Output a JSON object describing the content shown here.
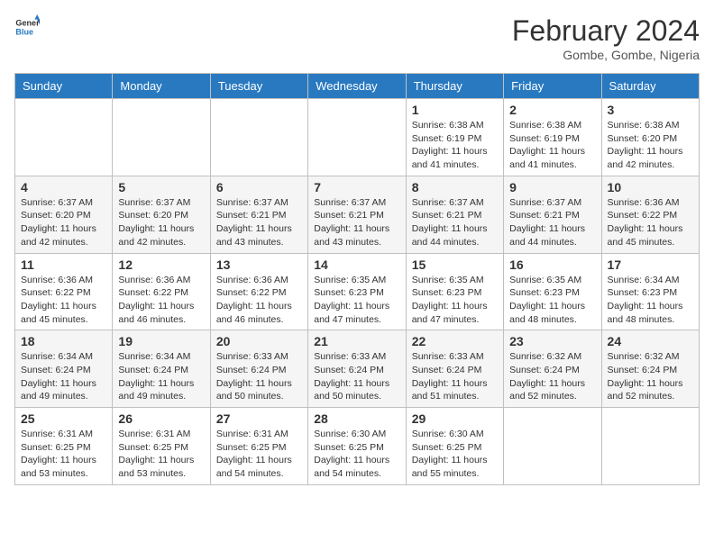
{
  "logo": {
    "line1": "General",
    "line2": "Blue"
  },
  "title": "February 2024",
  "subtitle": "Gombe, Gombe, Nigeria",
  "days_of_week": [
    "Sunday",
    "Monday",
    "Tuesday",
    "Wednesday",
    "Thursday",
    "Friday",
    "Saturday"
  ],
  "weeks": [
    [
      {
        "day": "",
        "info": ""
      },
      {
        "day": "",
        "info": ""
      },
      {
        "day": "",
        "info": ""
      },
      {
        "day": "",
        "info": ""
      },
      {
        "day": "1",
        "info": "Sunrise: 6:38 AM\nSunset: 6:19 PM\nDaylight: 11 hours and 41 minutes."
      },
      {
        "day": "2",
        "info": "Sunrise: 6:38 AM\nSunset: 6:19 PM\nDaylight: 11 hours and 41 minutes."
      },
      {
        "day": "3",
        "info": "Sunrise: 6:38 AM\nSunset: 6:20 PM\nDaylight: 11 hours and 42 minutes."
      }
    ],
    [
      {
        "day": "4",
        "info": "Sunrise: 6:37 AM\nSunset: 6:20 PM\nDaylight: 11 hours and 42 minutes."
      },
      {
        "day": "5",
        "info": "Sunrise: 6:37 AM\nSunset: 6:20 PM\nDaylight: 11 hours and 42 minutes."
      },
      {
        "day": "6",
        "info": "Sunrise: 6:37 AM\nSunset: 6:21 PM\nDaylight: 11 hours and 43 minutes."
      },
      {
        "day": "7",
        "info": "Sunrise: 6:37 AM\nSunset: 6:21 PM\nDaylight: 11 hours and 43 minutes."
      },
      {
        "day": "8",
        "info": "Sunrise: 6:37 AM\nSunset: 6:21 PM\nDaylight: 11 hours and 44 minutes."
      },
      {
        "day": "9",
        "info": "Sunrise: 6:37 AM\nSunset: 6:21 PM\nDaylight: 11 hours and 44 minutes."
      },
      {
        "day": "10",
        "info": "Sunrise: 6:36 AM\nSunset: 6:22 PM\nDaylight: 11 hours and 45 minutes."
      }
    ],
    [
      {
        "day": "11",
        "info": "Sunrise: 6:36 AM\nSunset: 6:22 PM\nDaylight: 11 hours and 45 minutes."
      },
      {
        "day": "12",
        "info": "Sunrise: 6:36 AM\nSunset: 6:22 PM\nDaylight: 11 hours and 46 minutes."
      },
      {
        "day": "13",
        "info": "Sunrise: 6:36 AM\nSunset: 6:22 PM\nDaylight: 11 hours and 46 minutes."
      },
      {
        "day": "14",
        "info": "Sunrise: 6:35 AM\nSunset: 6:23 PM\nDaylight: 11 hours and 47 minutes."
      },
      {
        "day": "15",
        "info": "Sunrise: 6:35 AM\nSunset: 6:23 PM\nDaylight: 11 hours and 47 minutes."
      },
      {
        "day": "16",
        "info": "Sunrise: 6:35 AM\nSunset: 6:23 PM\nDaylight: 11 hours and 48 minutes."
      },
      {
        "day": "17",
        "info": "Sunrise: 6:34 AM\nSunset: 6:23 PM\nDaylight: 11 hours and 48 minutes."
      }
    ],
    [
      {
        "day": "18",
        "info": "Sunrise: 6:34 AM\nSunset: 6:24 PM\nDaylight: 11 hours and 49 minutes."
      },
      {
        "day": "19",
        "info": "Sunrise: 6:34 AM\nSunset: 6:24 PM\nDaylight: 11 hours and 49 minutes."
      },
      {
        "day": "20",
        "info": "Sunrise: 6:33 AM\nSunset: 6:24 PM\nDaylight: 11 hours and 50 minutes."
      },
      {
        "day": "21",
        "info": "Sunrise: 6:33 AM\nSunset: 6:24 PM\nDaylight: 11 hours and 50 minutes."
      },
      {
        "day": "22",
        "info": "Sunrise: 6:33 AM\nSunset: 6:24 PM\nDaylight: 11 hours and 51 minutes."
      },
      {
        "day": "23",
        "info": "Sunrise: 6:32 AM\nSunset: 6:24 PM\nDaylight: 11 hours and 52 minutes."
      },
      {
        "day": "24",
        "info": "Sunrise: 6:32 AM\nSunset: 6:24 PM\nDaylight: 11 hours and 52 minutes."
      }
    ],
    [
      {
        "day": "25",
        "info": "Sunrise: 6:31 AM\nSunset: 6:25 PM\nDaylight: 11 hours and 53 minutes."
      },
      {
        "day": "26",
        "info": "Sunrise: 6:31 AM\nSunset: 6:25 PM\nDaylight: 11 hours and 53 minutes."
      },
      {
        "day": "27",
        "info": "Sunrise: 6:31 AM\nSunset: 6:25 PM\nDaylight: 11 hours and 54 minutes."
      },
      {
        "day": "28",
        "info": "Sunrise: 6:30 AM\nSunset: 6:25 PM\nDaylight: 11 hours and 54 minutes."
      },
      {
        "day": "29",
        "info": "Sunrise: 6:30 AM\nSunset: 6:25 PM\nDaylight: 11 hours and 55 minutes."
      },
      {
        "day": "",
        "info": ""
      },
      {
        "day": "",
        "info": ""
      }
    ]
  ]
}
